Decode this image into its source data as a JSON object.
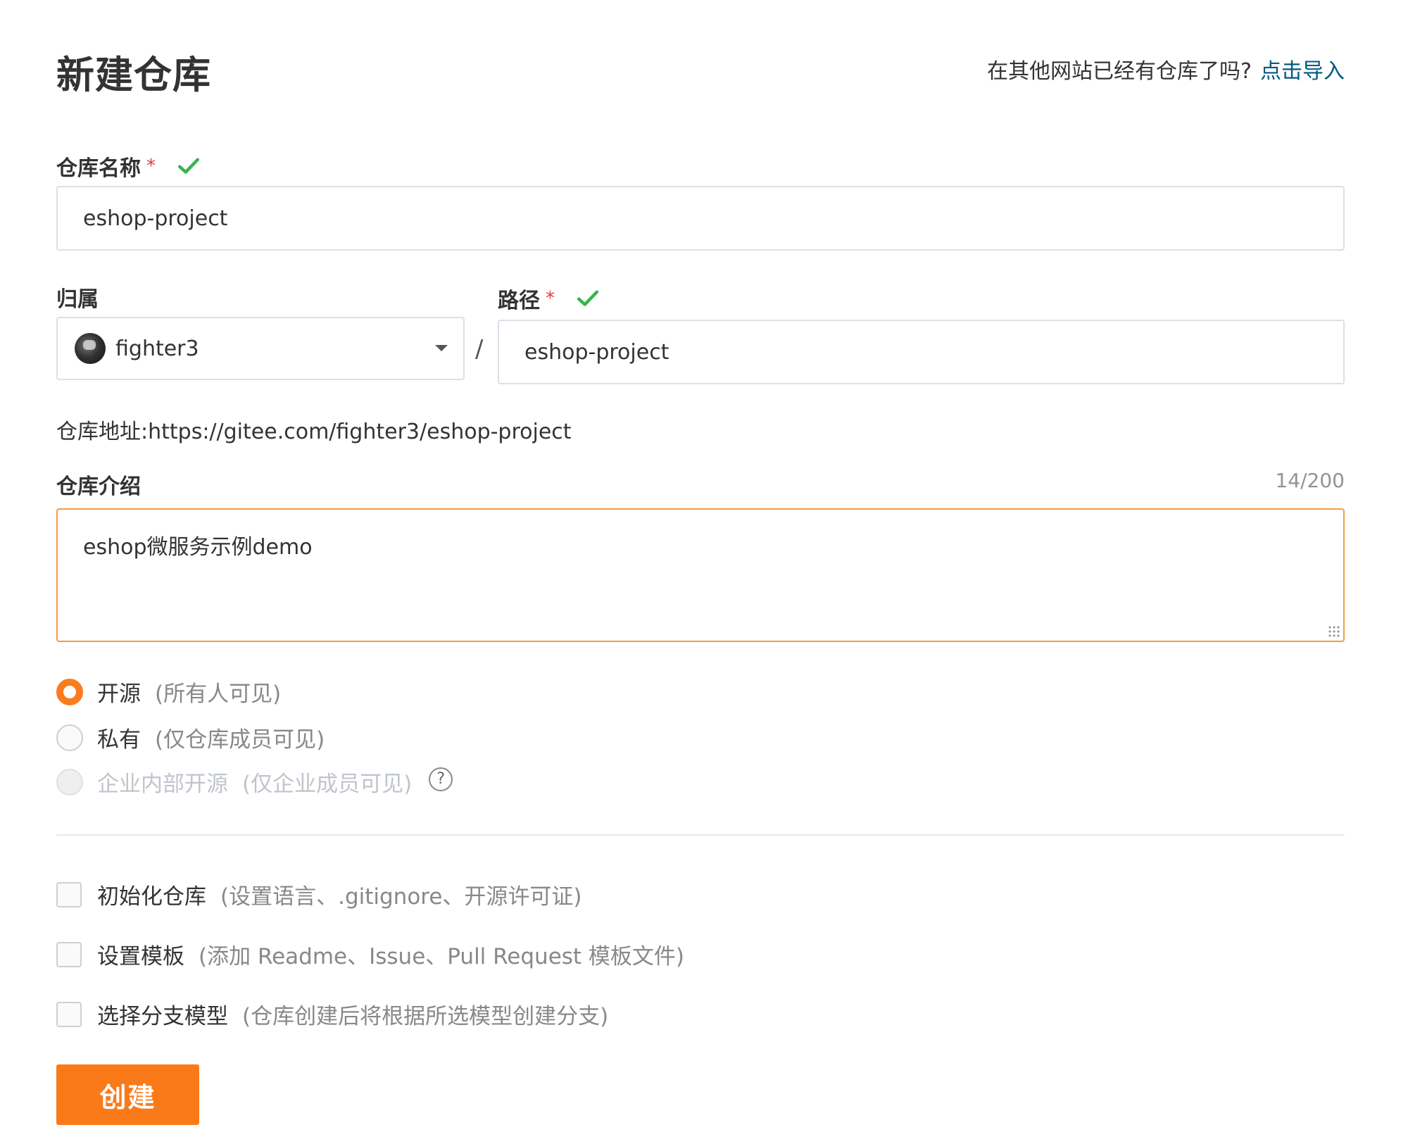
{
  "header": {
    "title": "新建仓库",
    "import_hint": "在其他网站已经有仓库了吗?",
    "import_link": "点击导入"
  },
  "repo_name": {
    "label": "仓库名称",
    "required": "*",
    "value": "eshop-project",
    "valid_icon": "check-icon"
  },
  "owner": {
    "label": "归属",
    "value": "fighter3",
    "avatar_icon": "avatar"
  },
  "separator": "/",
  "path": {
    "label": "路径",
    "required": "*",
    "value": "eshop-project"
  },
  "address": {
    "text": "仓库地址:https://gitee.com/fighter3/eshop-project"
  },
  "description": {
    "label": "仓库介绍",
    "count": "14/200",
    "value": "eshop微服务示例demo"
  },
  "visibility": {
    "options": [
      {
        "label": "开源",
        "hint": "(所有人可见)",
        "checked": true
      },
      {
        "label": "私有",
        "hint": "(仅仓库成员可见)",
        "checked": false
      },
      {
        "label": "企业内部开源",
        "hint": "(仅企业成员可见)",
        "checked": false,
        "disabled": true
      }
    ],
    "help_icon": "?"
  },
  "options": [
    {
      "label": "初始化仓库",
      "hint": "(设置语言、.gitignore、开源许可证)"
    },
    {
      "label": "设置模板",
      "hint": "(添加 Readme、Issue、Pull Request 模板文件)"
    },
    {
      "label": "选择分支模型",
      "hint": "(仓库创建后将根据所选模型创建分支)"
    }
  ],
  "actions": {
    "create_label": "创建"
  },
  "colors": {
    "accent": "#fa7a1a",
    "link": "#005980",
    "valid": "#3bb44a",
    "required": "#e4393c"
  }
}
